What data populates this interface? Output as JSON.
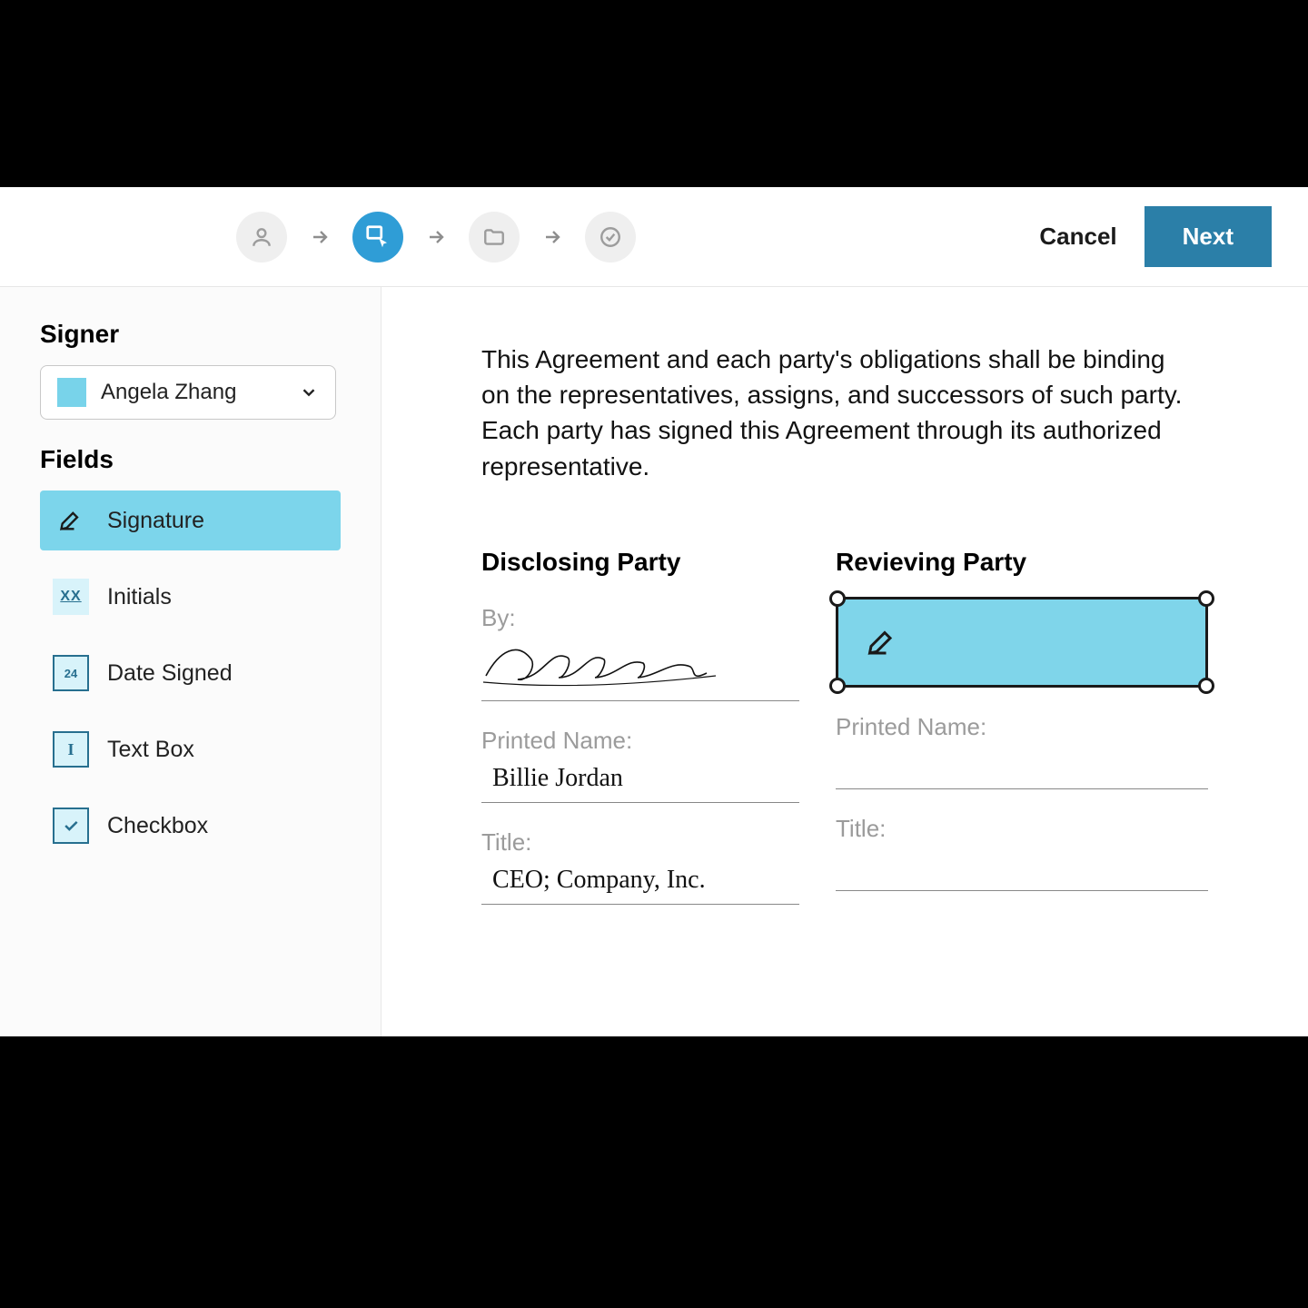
{
  "topbar": {
    "cancel_label": "Cancel",
    "next_label": "Next"
  },
  "sidebar": {
    "signer_heading": "Signer",
    "signer_selected": "Angela Zhang",
    "fields_heading": "Fields",
    "fields": [
      {
        "label": "Signature"
      },
      {
        "label": "Initials"
      },
      {
        "label": "Date Signed"
      },
      {
        "label": "Text Box"
      },
      {
        "label": "Checkbox"
      }
    ]
  },
  "document": {
    "paragraph": "This Agreement and each party's obligations shall be binding on the representatives, assigns, and successors of such party. Each party has signed this Agreement through its authorized representative.",
    "disclosing": {
      "heading": "Disclosing Party",
      "by_label": "By:",
      "printed_label": "Printed Name:",
      "printed_value": "Billie Jordan",
      "title_label": "Title:",
      "title_value": "CEO; Company, Inc."
    },
    "reviewing": {
      "heading": "Revieving Party",
      "printed_label": "Printed Name:",
      "title_label": "Title:"
    }
  },
  "icons": {
    "initials": "XX",
    "date": "24",
    "textbox": "I"
  }
}
